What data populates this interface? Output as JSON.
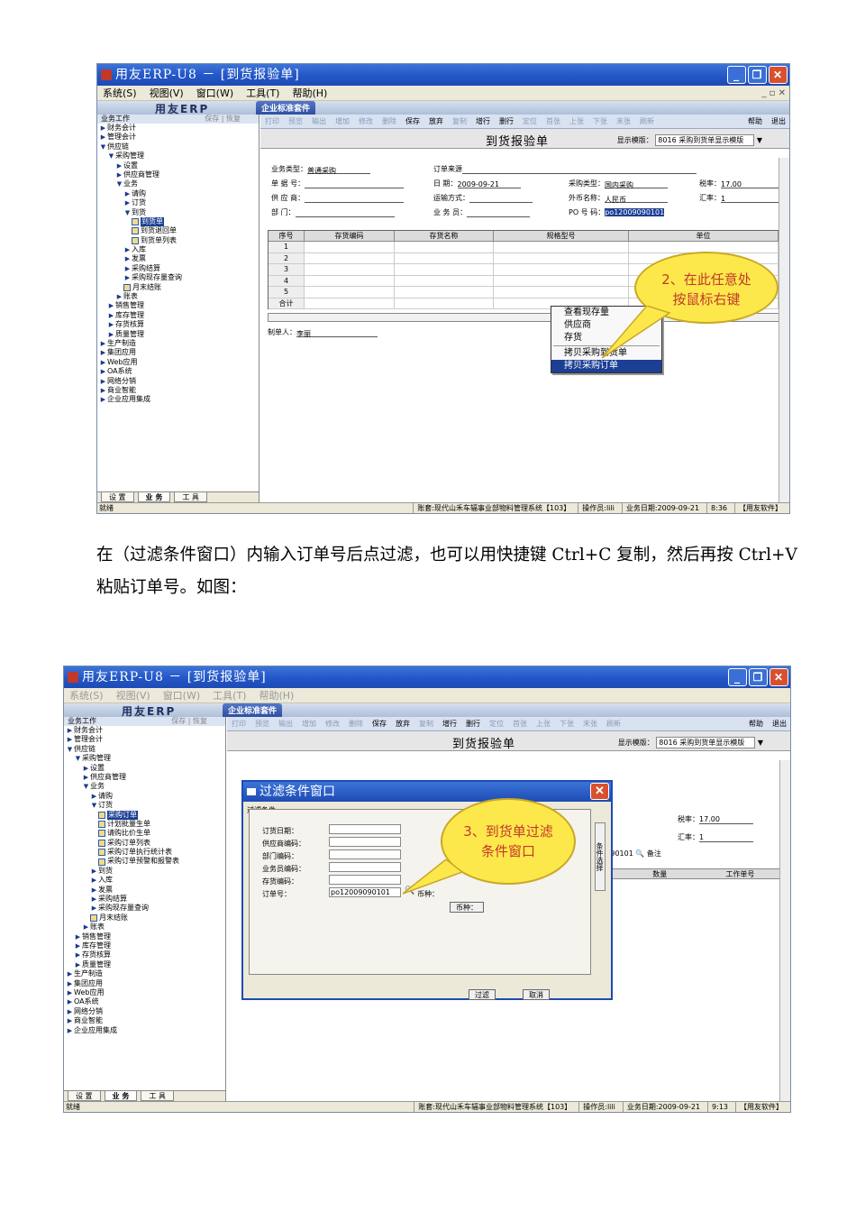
{
  "screenshot1": {
    "window_title": "用友ERP-U8 － [到货报验单]",
    "menus": [
      "系统(S)",
      "视图(V)",
      "窗口(W)",
      "工具(T)",
      "帮助(H)"
    ],
    "banner_logo": "用友ERP",
    "suite_tab": "企业标准套件",
    "sidebar_header": "业务工作",
    "sidebar_tools": "保存 | 恢复",
    "tree": [
      {
        "level": 0,
        "label": "财务会计",
        "kind": "closed"
      },
      {
        "level": 0,
        "label": "管理会计",
        "kind": "closed"
      },
      {
        "level": 0,
        "label": "供应链",
        "kind": "open"
      },
      {
        "level": 1,
        "label": "采购管理",
        "kind": "open"
      },
      {
        "level": 2,
        "label": "设置",
        "kind": "closed"
      },
      {
        "level": 2,
        "label": "供应商管理",
        "kind": "closed"
      },
      {
        "level": 2,
        "label": "业务",
        "kind": "open"
      },
      {
        "level": 3,
        "label": "请购",
        "kind": "closed"
      },
      {
        "level": 3,
        "label": "订货",
        "kind": "closed"
      },
      {
        "level": 3,
        "label": "到货",
        "kind": "open"
      },
      {
        "level": 4,
        "label": "到货单",
        "kind": "doc",
        "selected": true
      },
      {
        "level": 4,
        "label": "到货退回单",
        "kind": "doc"
      },
      {
        "level": 4,
        "label": "到货单列表",
        "kind": "doc"
      },
      {
        "level": 3,
        "label": "入库",
        "kind": "closed"
      },
      {
        "level": 3,
        "label": "发票",
        "kind": "closed"
      },
      {
        "level": 3,
        "label": "采购结算",
        "kind": "closed"
      },
      {
        "level": 3,
        "label": "采购现存量查询",
        "kind": "leaf"
      },
      {
        "level": 3,
        "label": "月末结账",
        "kind": "doc"
      },
      {
        "level": 2,
        "label": "账表",
        "kind": "closed"
      },
      {
        "level": 1,
        "label": "销售管理",
        "kind": "leaf"
      },
      {
        "level": 1,
        "label": "库存管理",
        "kind": "closed"
      },
      {
        "level": 1,
        "label": "存货核算",
        "kind": "leaf"
      },
      {
        "level": 1,
        "label": "质量管理",
        "kind": "leaf"
      },
      {
        "level": 0,
        "label": "生产制造",
        "kind": "closed"
      },
      {
        "level": 0,
        "label": "集团应用",
        "kind": "closed"
      },
      {
        "level": 0,
        "label": "Web应用",
        "kind": "closed"
      },
      {
        "level": 0,
        "label": "OA系统",
        "kind": "closed"
      },
      {
        "level": 0,
        "label": "网络分销",
        "kind": "closed"
      },
      {
        "level": 0,
        "label": "商业智能",
        "kind": "closed"
      },
      {
        "level": 0,
        "label": "企业应用集成",
        "kind": "closed"
      }
    ],
    "side_tabs": [
      "设 置",
      "业 务",
      "工 具"
    ],
    "toolbar": [
      "打印",
      "预览",
      "输出",
      "增加",
      "修改",
      "删除",
      "保存",
      "放弃",
      "复制",
      "增行",
      "删行",
      "定位",
      "首张",
      "上张",
      "下张",
      "末张",
      "刷新",
      "帮助",
      "退出"
    ],
    "form_title": "到货报验单",
    "template_label": "显示模版：",
    "template_value": "8016 采购到货单显示模版",
    "fields": {
      "biz_type_label": "业务类型：",
      "biz_type": "普通采购",
      "order_src_label": "订单来源",
      "doc_no_label": "单 据 号：",
      "date_label": "日    期：",
      "date": "2009-09-21",
      "purchase_type_label": "采购类型：",
      "purchase_type": "国内采购",
      "tax_label": "税率：",
      "tax": "17.00",
      "vendor_label": "供 应 商：",
      "ship_label": "运输方式：",
      "currency_label": "外币名称：",
      "currency": "人民币",
      "rate_label": "汇率：",
      "rate": "1",
      "dept_label": "部    门：",
      "staff_label": "业 务 员：",
      "po_label": "PO 号 码：",
      "po": "po12009090101"
    },
    "grid_headers": [
      "序号",
      "存货编码",
      "存货名称",
      "规格型号",
      "单位"
    ],
    "grid_rows": [
      "1",
      "2",
      "3",
      "4",
      "5",
      "合计"
    ],
    "maker_label": "制单人：",
    "maker": "李丽",
    "context_menu": [
      "查看现存量",
      "供应商",
      "存货",
      "拷贝采购到货单",
      "拷贝采购订单"
    ],
    "balloon": "2、在此任意处按鼠标右键",
    "status_left": "就绪",
    "status_right": [
      "账套:现代山禾车辐事业部物料管理系统【103】",
      "操作员:lili",
      "业务日期:2009-09-21",
      "8:36",
      "【用友软件】"
    ]
  },
  "paragraph": "在（过滤条件窗口）内输入订单号后点过滤，也可以用快捷键 Ctrl+C 复制，然后再按 Ctrl+V 粘贴订单号。如图：",
  "screenshot2": {
    "window_title": "用友ERP-U8 － [到货报验单]",
    "menus": [
      "系统(S)",
      "视图(V)",
      "窗口(W)",
      "工具(T)",
      "帮助(H)"
    ],
    "tree": [
      {
        "level": 0,
        "label": "财务会计",
        "kind": "closed"
      },
      {
        "level": 0,
        "label": "管理会计",
        "kind": "closed"
      },
      {
        "level": 0,
        "label": "供应链",
        "kind": "open"
      },
      {
        "level": 1,
        "label": "采购管理",
        "kind": "open"
      },
      {
        "level": 2,
        "label": "设置",
        "kind": "closed"
      },
      {
        "level": 2,
        "label": "供应商管理",
        "kind": "closed"
      },
      {
        "level": 2,
        "label": "业务",
        "kind": "open"
      },
      {
        "level": 3,
        "label": "请购",
        "kind": "closed"
      },
      {
        "level": 3,
        "label": "订货",
        "kind": "open"
      },
      {
        "level": 4,
        "label": "采购订单",
        "kind": "doc",
        "selected": true
      },
      {
        "level": 4,
        "label": "计划批量生单",
        "kind": "doc"
      },
      {
        "level": 4,
        "label": "请购比价生单",
        "kind": "doc"
      },
      {
        "level": 4,
        "label": "采购订单列表",
        "kind": "doc"
      },
      {
        "level": 4,
        "label": "采购订单执行统计表",
        "kind": "doc"
      },
      {
        "level": 4,
        "label": "采购订单预警和报警表",
        "kind": "doc"
      },
      {
        "level": 3,
        "label": "到货",
        "kind": "closed"
      },
      {
        "level": 3,
        "label": "入库",
        "kind": "closed"
      },
      {
        "level": 3,
        "label": "发票",
        "kind": "closed"
      },
      {
        "level": 3,
        "label": "采购结算",
        "kind": "closed"
      },
      {
        "level": 3,
        "label": "采购现存量查询",
        "kind": "leaf"
      },
      {
        "level": 3,
        "label": "月末结账",
        "kind": "doc"
      },
      {
        "level": 2,
        "label": "账表",
        "kind": "closed"
      },
      {
        "level": 1,
        "label": "销售管理",
        "kind": "leaf"
      },
      {
        "level": 1,
        "label": "库存管理",
        "kind": "leaf"
      },
      {
        "level": 1,
        "label": "存货核算",
        "kind": "leaf"
      },
      {
        "level": 1,
        "label": "质量管理",
        "kind": "leaf"
      },
      {
        "level": 0,
        "label": "生产制造",
        "kind": "closed"
      },
      {
        "level": 0,
        "label": "集团应用",
        "kind": "closed"
      },
      {
        "level": 0,
        "label": "Web应用",
        "kind": "closed"
      },
      {
        "level": 0,
        "label": "OA系统",
        "kind": "closed"
      },
      {
        "level": 0,
        "label": "网络分销",
        "kind": "closed"
      },
      {
        "level": 0,
        "label": "商业智能",
        "kind": "closed"
      },
      {
        "level": 0,
        "label": "企业应用集成",
        "kind": "closed"
      }
    ],
    "form_title": "到货报验单",
    "template_value": "8016 采购到货单显示模版",
    "bg_fields": {
      "purchase_type": "采购",
      "tax_label": "税率：",
      "tax": "17.00",
      "currency": "币",
      "rate_label": "汇率：",
      "rate": "1",
      "po_partial": "009090101",
      "remark_label": "备注"
    },
    "bg_grid_headers": [
      "位",
      "数量",
      "工作单号"
    ],
    "dialog": {
      "title": "过滤条件窗口",
      "group": "过滤条件",
      "labels": [
        "订货日期：",
        "供应商编码：",
        "部门编码：",
        "业务员编码：",
        "存货编码：",
        "订单号："
      ],
      "order_no": "po12009090101",
      "currency_label": "币种：",
      "currency_button": "币种：",
      "side_tab": "条件选择",
      "filter_button": "过滤",
      "cancel_button": "取消"
    },
    "balloon": "3、到货单过滤条件窗口",
    "status_left": "就绪",
    "status_right": [
      "账套:现代山禾车辐事业部物料管理系统【103】",
      "操作员:lili",
      "业务日期:2009-09-21",
      "9:13",
      "【用友软件】"
    ]
  }
}
